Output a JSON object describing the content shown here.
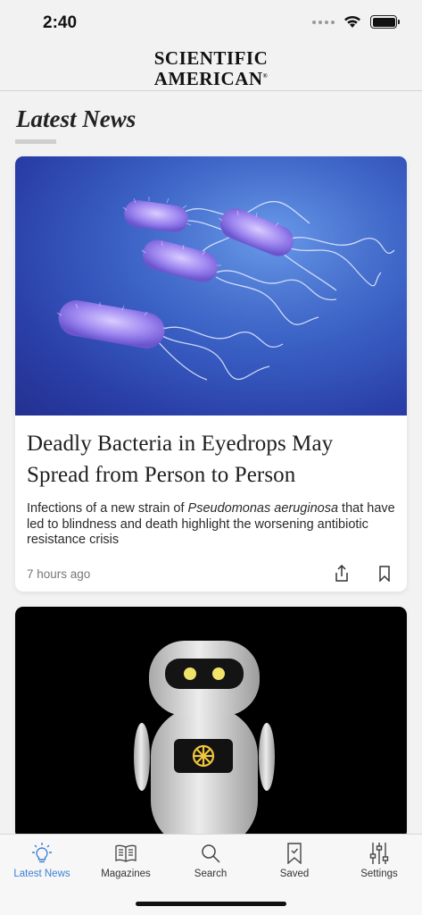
{
  "status_bar": {
    "time": "2:40"
  },
  "header": {
    "logo_line1": "SCIENTIFIC",
    "logo_line2": "AMERICAN",
    "logo_mark": "®"
  },
  "section": {
    "title": "Latest News"
  },
  "articles": [
    {
      "headline": "Deadly Bacteria in Eyedrops May Spread from Person to Person",
      "dek_before": "Infections of a new strain of ",
      "dek_italic": "Pseudomonas aeruginosa",
      "dek_after": " that have led to blindness and death highlight the worsening antibiotic resistance crisis",
      "timestamp": "7 hours ago",
      "share_icon": "share-icon",
      "bookmark_icon": "bookmark-icon"
    }
  ],
  "tabs": [
    {
      "label": "Latest News",
      "icon": "lightbulb-icon",
      "active": true
    },
    {
      "label": "Magazines",
      "icon": "magazine-icon",
      "active": false
    },
    {
      "label": "Search",
      "icon": "search-icon",
      "active": false
    },
    {
      "label": "Saved",
      "icon": "bookmark-icon",
      "active": false
    },
    {
      "label": "Settings",
      "icon": "sliders-icon",
      "active": false
    }
  ],
  "colors": {
    "accent": "#3b7fd4",
    "background": "#f2f2f2",
    "card": "#ffffff"
  }
}
